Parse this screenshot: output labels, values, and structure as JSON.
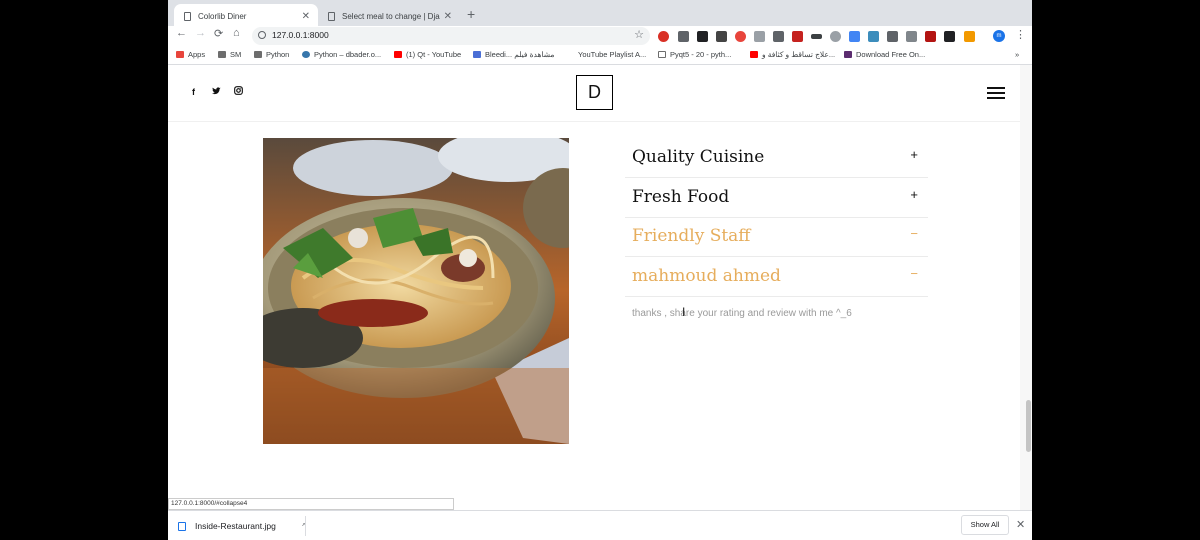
{
  "browser": {
    "tabs": [
      {
        "title": "Colorlib Diner",
        "active": true
      },
      {
        "title": "Select meal to change | Django",
        "active": false
      }
    ],
    "new_tab": "+",
    "nav": {
      "back": "←",
      "forward": "→",
      "reload": "⟳",
      "home": "⌂"
    },
    "address": "127.0.0.1:8000",
    "star": "☆",
    "profile": "m",
    "menu": "⋮",
    "bookmarks": [
      {
        "label": "Apps",
        "color": "#e8453c"
      },
      {
        "label": "SM",
        "color": "#6d6d6d"
      },
      {
        "label": "Python",
        "color": "#6d6d6d"
      },
      {
        "label": "Python – dbader.o...",
        "color": "#3776ab"
      },
      {
        "label": "(1) Qt - YouTube",
        "color": "#ff0000"
      },
      {
        "label": "Bleedi... مشاهدة فيلم",
        "color": "#4a6fd6"
      },
      {
        "label": "YouTube Playlist A...",
        "color": "#ffffff"
      },
      {
        "label": "Pyqt5 - 20 - pyth...",
        "color": "#6d6d6d"
      },
      {
        "label": "علاج تساقط و كثافة و...",
        "color": "#ff0000"
      },
      {
        "label": "Download Free On...",
        "color": "#5b2c6f"
      }
    ],
    "bookmarks_more": "»"
  },
  "site": {
    "social": {
      "facebook": "f",
      "twitter": "🐦",
      "instagram": "◎"
    },
    "logo": "D",
    "accordion": [
      {
        "title": "Quality Cuisine",
        "toggle": "+",
        "open": false
      },
      {
        "title": "Fresh Food",
        "toggle": "+",
        "open": false
      },
      {
        "title": "Friendly Staff",
        "toggle": "−",
        "open": true
      },
      {
        "title": "mahmoud ahmed",
        "toggle": "−",
        "open": true
      }
    ],
    "accordion_body": "thanks , share your rating and review with me ^_6"
  },
  "status_url": "127.0.0.1:8000/#collapse4",
  "downloads": {
    "file_name": "Inside-Restaurant.jpg",
    "chevron": "^",
    "show_all": "Show All",
    "close": "✕"
  },
  "colors": {
    "accent": "#e6ad5c",
    "tab_strip": "#dee1e6"
  }
}
